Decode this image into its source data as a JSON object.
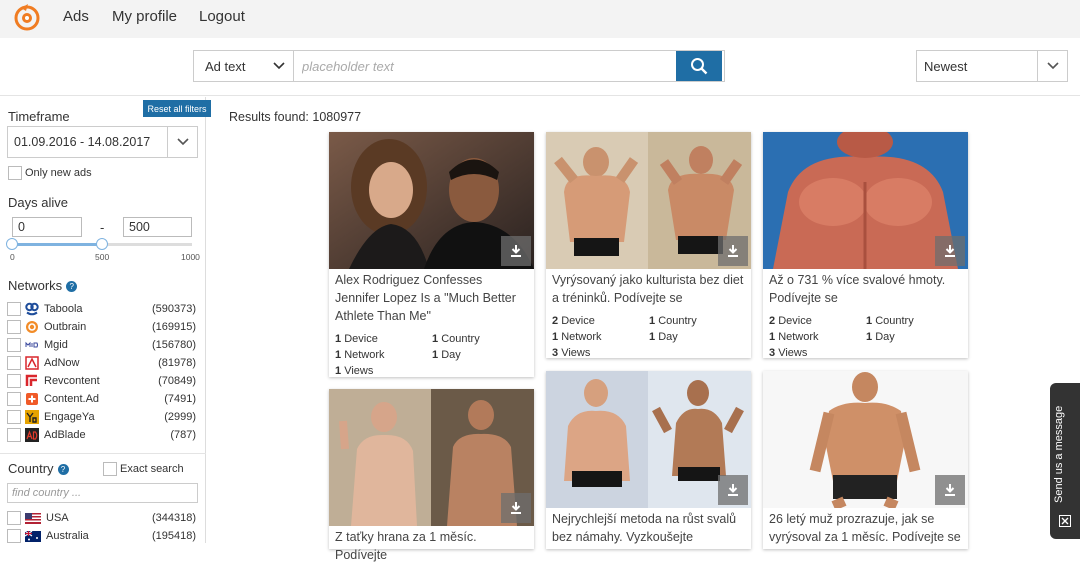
{
  "nav": {
    "links": [
      "Ads",
      "My profile",
      "Logout"
    ]
  },
  "search": {
    "type_label": "Ad text",
    "placeholder": "placeholder text",
    "sort_label": "Newest"
  },
  "sidebar": {
    "reset_label": "Reset all filters",
    "timeframe_label": "Timeframe",
    "timeframe_value": "01.09.2016 - 14.08.2017",
    "only_new_label": "Only new ads",
    "days_alive_label": "Days alive",
    "days_min": "0",
    "days_sep": "-",
    "days_max": "500",
    "slider_ticks": [
      "0",
      "500",
      "1000"
    ],
    "slider_range": [
      0,
      500
    ],
    "slider_max": 1000,
    "networks_label": "Networks",
    "networks": [
      {
        "name": "Taboola",
        "count": "(590373)",
        "icon": "taboola-icon",
        "color": "#1e4d9b"
      },
      {
        "name": "Outbrain",
        "count": "(169915)",
        "icon": "outbrain-icon",
        "color": "#f28c28"
      },
      {
        "name": "Mgid",
        "count": "(156780)",
        "icon": "mgid-icon",
        "color": "#3b4a9e"
      },
      {
        "name": "AdNow",
        "count": "(81978)",
        "icon": "adnow-icon",
        "color": "#d9262c"
      },
      {
        "name": "Revcontent",
        "count": "(70849)",
        "icon": "revcontent-icon",
        "color": "#d9262c"
      },
      {
        "name": "Content.Ad",
        "count": "(7491)",
        "icon": "contentad-icon",
        "color": "#f05a28"
      },
      {
        "name": "EngageYa",
        "count": "(2999)",
        "icon": "engageya-icon",
        "color": "#e6a300"
      },
      {
        "name": "AdBlade",
        "count": "(787)",
        "icon": "adblade-icon",
        "color": "#222222"
      }
    ],
    "country_label": "Country",
    "exact_search_label": "Exact search",
    "find_country_placeholder": "find country ...",
    "countries": [
      {
        "name": "USA",
        "count": "(344318)",
        "icon": "us-flag-icon"
      },
      {
        "name": "Australia",
        "count": "(195418)",
        "icon": "au-flag-icon"
      }
    ]
  },
  "results": {
    "label": "Results found: 1080977"
  },
  "cards": [
    {
      "title": "Alex Rodriguez Confesses Jennifer Lopez Is a \"Much Better Athlete Than Me\"",
      "devices": "1",
      "device_label": "Device",
      "countries": "1",
      "country_label": "Country",
      "networks": "1",
      "network_label": "Network",
      "days": "1",
      "day_label": "Day",
      "views": "1",
      "views_label": "Views"
    },
    {
      "title": "Vyrýsovaný jako kulturista bez diet a tréninků. Podívejte se",
      "devices": "2",
      "device_label": "Device",
      "countries": "1",
      "country_label": "Country",
      "networks": "1",
      "network_label": "Network",
      "days": "1",
      "day_label": "Day",
      "views": "3",
      "views_label": "Views"
    },
    {
      "title": "Až o 731 % více svalové hmoty. Podívejte se",
      "devices": "2",
      "device_label": "Device",
      "countries": "1",
      "country_label": "Country",
      "networks": "1",
      "network_label": "Network",
      "days": "1",
      "day_label": "Day",
      "views": "3",
      "views_label": "Views"
    },
    {
      "title": "Z taťky hrana za 1 měsíc. Podívejte"
    },
    {
      "title": "Nejrychlejší metoda na růst svalů bez námahy. Vyzkoušejte"
    },
    {
      "title": "26 letý muž prozrazuje, jak se vyrýsoval za 1 měsíc. Podívejte se"
    }
  ],
  "feedback": {
    "label": "Send us a message"
  },
  "colors": {
    "accent": "#1f6ea5",
    "nav_bg": "#f3f3f3"
  }
}
